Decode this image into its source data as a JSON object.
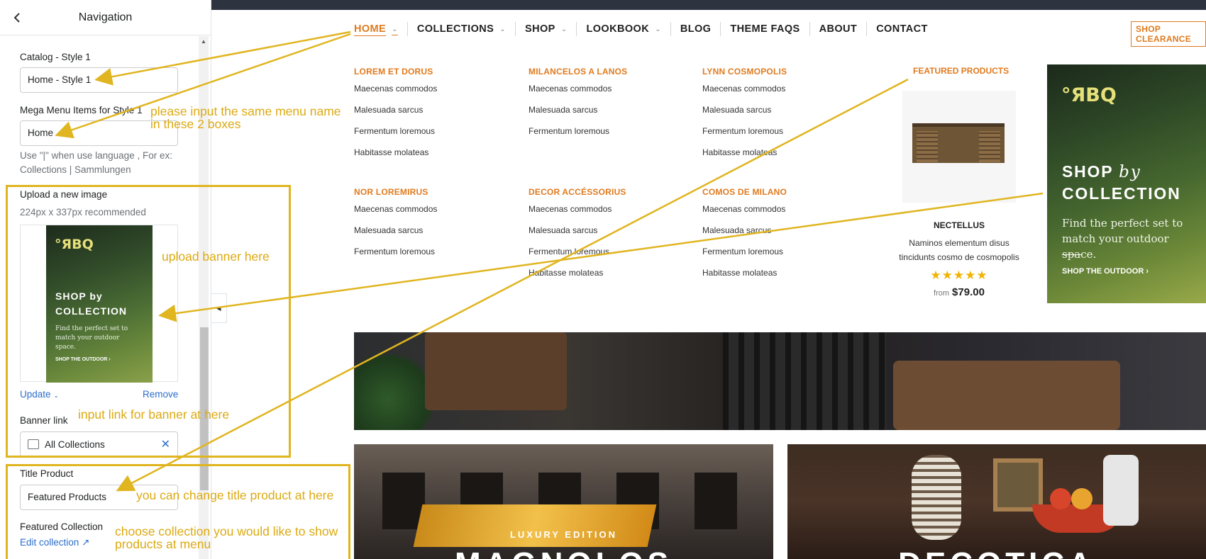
{
  "editor": {
    "title": "Navigation",
    "catalog_label": "Catalog - Style 1",
    "catalog_value": "Home - Style 1",
    "mega_label": "Mega Menu Items for Style 1",
    "mega_value": "Home",
    "mega_help": "Use \"|\" when use language , For ex: Collections | Sammlungen",
    "upload_label": "Upload a new image",
    "upload_help": "224px x 337px recommended",
    "banner_preview": {
      "logo": "°ЯBQ",
      "line1": "SHOP by",
      "line2": "COLLECTION",
      "text": "Find the perfect set to match your outdoor space.",
      "cta": "SHOP THE OUTDOOR ›"
    },
    "update_label": "Update",
    "remove_label": "Remove",
    "banner_link_label": "Banner link",
    "banner_link_value": "All Collections",
    "title_product_label": "Title Product",
    "title_product_value": "Featured Products",
    "featured_collection_label": "Featured Collection",
    "edit_collection_label": "Edit collection"
  },
  "store": {
    "nav": [
      "HOME",
      "COLLECTIONS",
      "SHOP",
      "LOOKBOOK",
      "BLOG",
      "THEME FAQS",
      "ABOUT",
      "CONTACT"
    ],
    "clearance": "SHOP CLEARANCE",
    "menu_columns": [
      {
        "heading": "LOREM ET DORUS",
        "links": [
          "Maecenas commodos",
          "Malesuada sarcus",
          "Fermentum loremous",
          "Habitasse molateas"
        ]
      },
      {
        "heading": "MILANCELOS A LANOS",
        "links": [
          "Maecenas commodos",
          "Malesuada sarcus",
          "Fermentum loremous"
        ]
      },
      {
        "heading": "LYNN COSMOPOLIS",
        "links": [
          "Maecenas commodos",
          "Malesuada sarcus",
          "Fermentum loremous",
          "Habitasse molateas"
        ]
      },
      {
        "heading": "NOR LOREMIRUS",
        "links": [
          "Maecenas commodos",
          "Malesuada sarcus",
          "Fermentum loremous"
        ]
      },
      {
        "heading": "DECOR ACCÉSSORIUS",
        "links": [
          "Maecenas commodos",
          "Malesuada sarcus",
          "Fermentum loremous",
          "Habitasse molateas"
        ]
      },
      {
        "heading": "COMOS DE MILANO",
        "links": [
          "Maecenas commodos",
          "Malesuada sarcus",
          "Fermentum loremous",
          "Habitasse molateas"
        ]
      }
    ],
    "featured": {
      "title": "FEATURED PRODUCTS",
      "name": "NECTELLUS",
      "desc": "Naminos elementum disus tincidunts cosmo de cosmopolis",
      "stars": "★★★★★",
      "from": "from",
      "price": "$79.00"
    },
    "banner": {
      "logo": "°ЯBQ",
      "line1": "SHOP",
      "line1_italic": "by",
      "line2": "COLLECTION",
      "text": "Find the perfect set to match your outdoor space.",
      "cta": "SHOP THE OUTDOOR ›"
    },
    "card1_edition": "LUXURY EDITION",
    "card1_title": "MAGNOLOS",
    "card2_title": "DECOTICA"
  },
  "notes": {
    "same_name_1": "please input the same menu name",
    "same_name_2": "in these 2 boxes",
    "upload_banner": "upload banner here",
    "input_link": "input link for banner at here",
    "change_title": "you can change title product at here",
    "choose_collection_1": "choose collection you would like to show",
    "choose_collection_2": "products at menu"
  },
  "colors": {
    "accent": "#e07b1f",
    "annotation": "#e0b520",
    "link": "#2c6ecb",
    "topbar": "#2e3340"
  }
}
